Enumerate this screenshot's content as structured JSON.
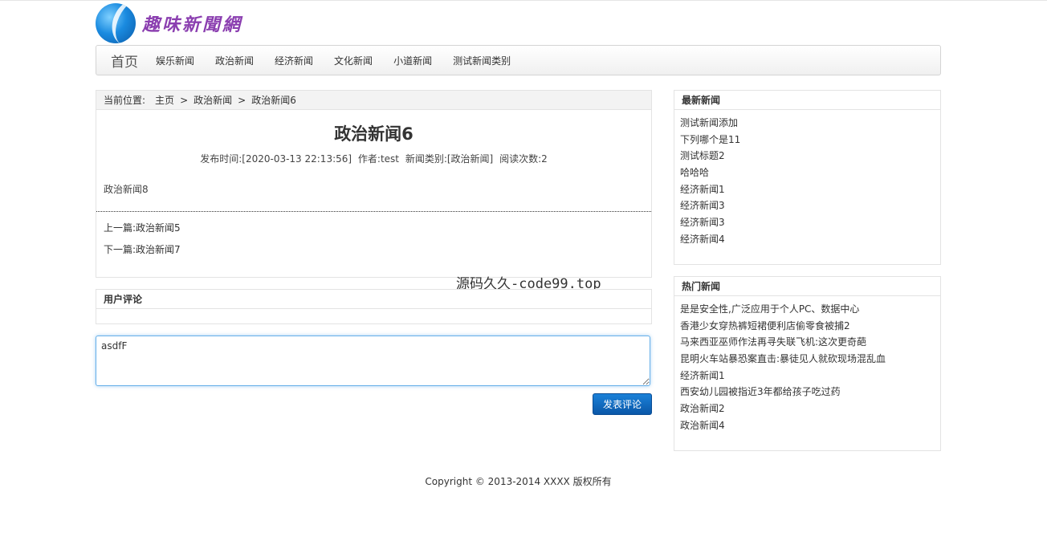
{
  "site": {
    "logo_text": "趣味新聞網"
  },
  "nav": {
    "home": "首页",
    "items": [
      "娱乐新闻",
      "政治新闻",
      "经济新闻",
      "文化新闻",
      "小道新闻",
      "测试新闻类别"
    ]
  },
  "breadcrumb": {
    "prefix": "当前位置:",
    "items": [
      "主页",
      "政治新闻",
      "政治新闻6"
    ],
    "separator": ">"
  },
  "article": {
    "title": "政治新闻6",
    "meta": {
      "publish_time": "发布时间:[2020-03-13 22:13:56]",
      "author": "作者:test",
      "category": "新闻类别:[政治新闻]",
      "reads": "阅读次数:2"
    },
    "body": "政治新闻8",
    "prev": "上一篇:政治新闻5",
    "next": "下一篇:政治新闻7"
  },
  "comments": {
    "heading": "用户评论",
    "input_value": "asdfF",
    "submit_label": "发表评论"
  },
  "watermark": "源码久久-code99.top",
  "sidebar": {
    "latest": {
      "heading": "最新新闻",
      "items": [
        "测试新闻添加",
        "下列哪个是11",
        "测试标题2",
        "哈哈哈",
        "经济新闻1",
        "经济新闻3",
        "经济新闻3",
        "经济新闻4"
      ]
    },
    "hot": {
      "heading": "热门新闻",
      "items": [
        "是是安全性,广泛应用于个人PC、数据中心",
        "香港少女穿热裤短裙便利店偷零食被捕2",
        "马来西亚巫师作法再寻失联飞机:这次更奇葩",
        "昆明火车站暴恐案直击:暴徒见人就砍现场混乱血",
        "经济新闻1",
        "西安幼儿园被指近3年都给孩子吃过药",
        "政治新闻2",
        "政治新闻4"
      ]
    }
  },
  "footer": {
    "copyright": "Copyright © 2013-2014 XXXX 版权所有"
  }
}
